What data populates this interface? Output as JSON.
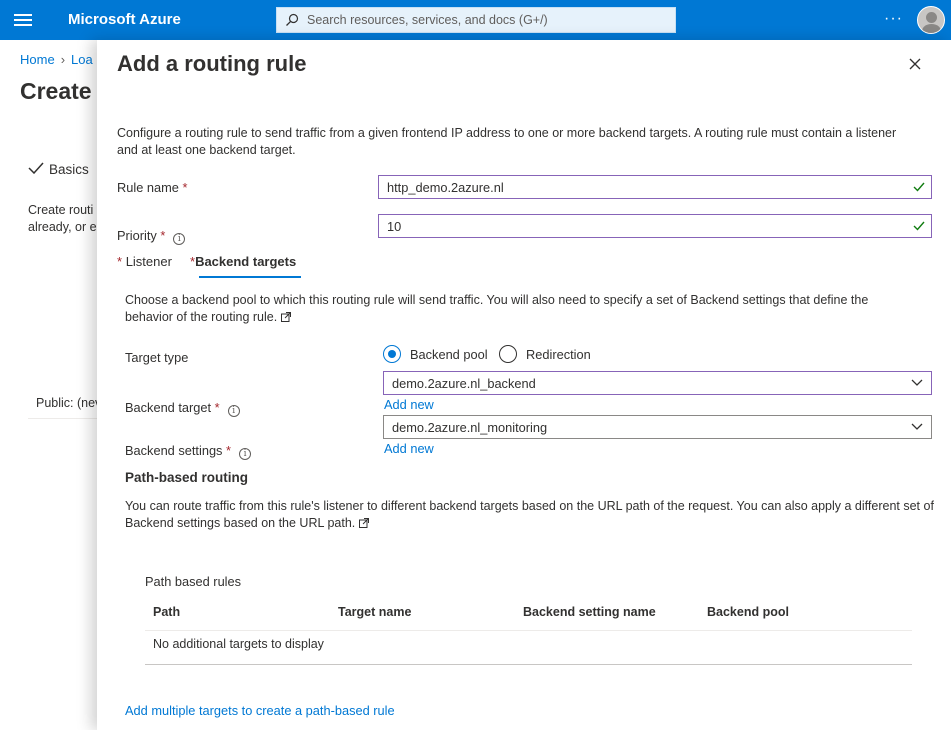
{
  "topbar": {
    "brand": "Microsoft Azure",
    "search_placeholder": "Search resources, services, and docs (G+/)",
    "more": "···"
  },
  "background": {
    "breadcrumb_home": "Home",
    "breadcrumb_next": "Loa",
    "title": "Create",
    "step_basics": "Basics",
    "create_text_1": "Create routi",
    "create_text_2": "already, or e",
    "public_text": "Public: (nev"
  },
  "blade": {
    "title": "Add a routing rule",
    "intro": "Configure a routing rule to send traffic from a given frontend IP address to one or more backend targets. A routing rule must contain a listener and at least one backend target.",
    "rule_name_label": "Rule name",
    "rule_name_value": "http_demo.2azure.nl",
    "priority_label": "Priority",
    "priority_value": "10",
    "required_mark": "*",
    "info_glyph": "i",
    "tabs": [
      {
        "label": "Listener"
      },
      {
        "label": "Backend targets"
      }
    ],
    "backend": {
      "description": "Choose a backend pool to which this routing rule will send traffic. You will also need to specify a set of Backend settings that define the behavior of the routing rule.",
      "target_type_label": "Target type",
      "option_pool": "Backend pool",
      "option_redirect": "Redirection",
      "backend_target_label": "Backend target",
      "backend_target_value": "demo.2azure.nl_backend",
      "add_new_1": "Add new",
      "backend_settings_label": "Backend settings",
      "backend_settings_value": "demo.2azure.nl_monitoring",
      "add_new_2": "Add new"
    },
    "path_routing": {
      "heading": "Path-based routing",
      "description": "You can route traffic from this rule's listener to different backend targets based on the URL path of the request. You can also apply a different set of Backend settings based on the URL path.",
      "rules_label": "Path based rules",
      "columns": [
        "Path",
        "Target name",
        "Backend setting name",
        "Backend pool"
      ],
      "empty_text": "No additional targets to display",
      "add_multiple_link": "Add multiple targets to create a path-based rule"
    }
  },
  "colors": {
    "azure_blue": "#0078d4",
    "valid_green": "#107c10",
    "focus_purple": "#8764b8",
    "required_red": "#a4262c"
  }
}
